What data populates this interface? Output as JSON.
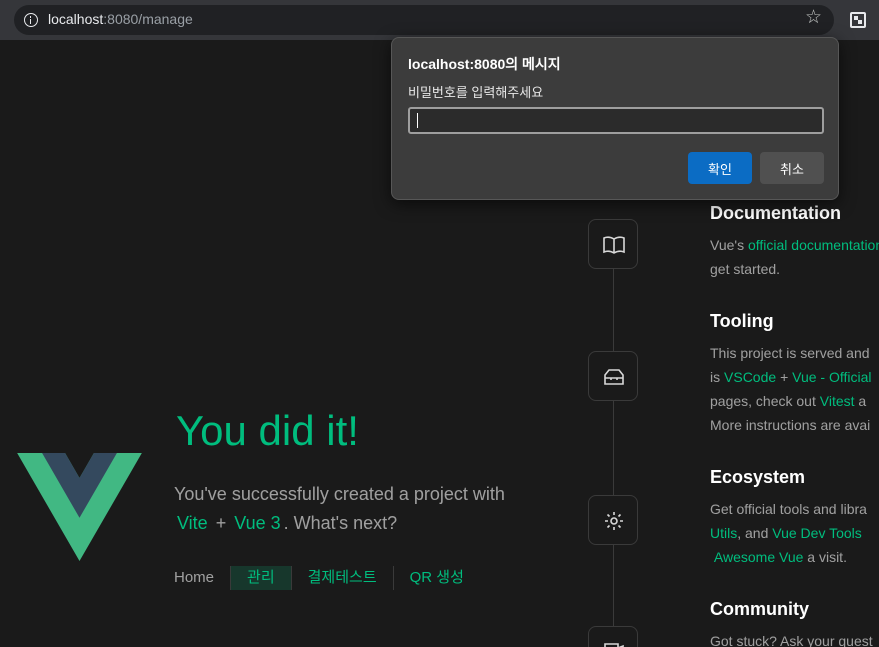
{
  "browser": {
    "url_host": "localhost",
    "url_path": ":8080/manage"
  },
  "hero": {
    "title": "You did it!",
    "text_before": "You've successfully created a project with",
    "link_vite": "Vite",
    "plus": "+",
    "link_vue": "Vue 3",
    "text_after": ". What's next?"
  },
  "nav": {
    "items": [
      "Home",
      "관리",
      "결제테스트",
      "QR 생성"
    ]
  },
  "sections": {
    "documentation": {
      "title": "Documentation",
      "line1_prefix": "Vue's",
      "line1_link": "official documentation",
      "line2": "get started."
    },
    "tooling": {
      "title": "Tooling",
      "line1": "This project is served and",
      "line2_prefix": "is",
      "line2_link1": "VSCode",
      "line2_plus": "+",
      "line2_link2": "Vue - Official",
      "line3_prefix": "pages, check out",
      "line3_link": "Vitest",
      "line3_suffix": "a",
      "line4": "More instructions are avai"
    },
    "ecosystem": {
      "title": "Ecosystem",
      "line1": "Get official tools and libra",
      "line2_link1": "Utils",
      "line2_mid": ", and",
      "line2_link2": "Vue Dev Tools",
      "line3_link": "Awesome Vue",
      "line3_suffix": "a visit."
    },
    "community": {
      "title": "Community",
      "line1": "Got stuck? Ask your quest"
    }
  },
  "dialog": {
    "title": "localhost:8080의 메시지",
    "message": "비밀번호를 입력해주세요",
    "input_value": "",
    "ok_label": "확인",
    "cancel_label": "취소"
  },
  "colors": {
    "accent_green": "#00bd7e",
    "page_bg": "#1a1a1a",
    "dialog_bg": "#3c3c3c",
    "ok_button": "#0b6cc4"
  }
}
